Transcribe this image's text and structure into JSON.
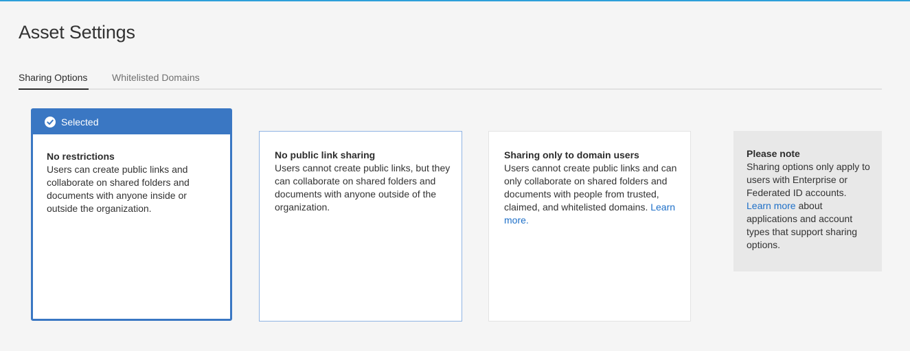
{
  "header": {
    "title": "Asset Settings"
  },
  "tabs": [
    {
      "label": "Sharing Options",
      "active": true
    },
    {
      "label": "Whitelisted Domains",
      "active": false
    }
  ],
  "colors": {
    "accent": "#3a77c3",
    "link": "#1d6fc8",
    "top_rule": "#2d9fd9",
    "note_bg": "#e8e8e8"
  },
  "options": [
    {
      "badge": "Selected",
      "badge_icon": "checkmark-circle-icon",
      "title": "No restrictions",
      "description": "Users can create public links and collaborate on shared folders and documents with anyone inside or outside the organization.",
      "selected": true
    },
    {
      "title": "No public link sharing",
      "description": "Users cannot create public links, but they can collaborate on shared folders and documents with anyone outside of the organization.",
      "selected": false
    },
    {
      "title": "Sharing only to domain users",
      "description": "Users cannot create public links and can only collaborate on shared folders and documents with people from trusted, claimed, and whitelisted domains.",
      "link": "Learn more.",
      "selected": false
    }
  ],
  "note": {
    "title": "Please note",
    "text_before_link": "Sharing options only apply to users with Enterprise or Federated ID accounts.",
    "link": "Learn more",
    "text_after_link": "about applications and account types that support sharing options."
  }
}
